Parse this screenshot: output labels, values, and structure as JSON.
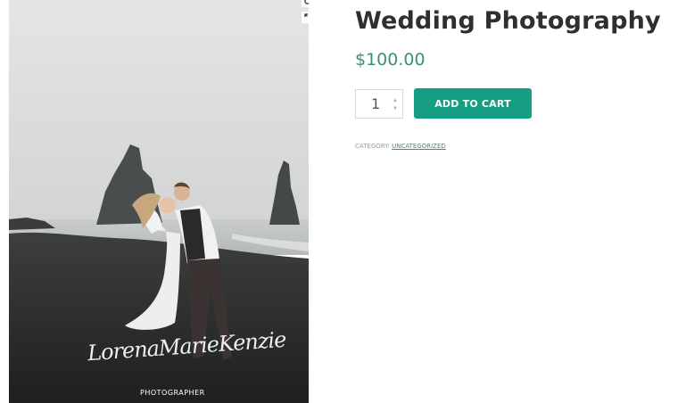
{
  "product": {
    "title": "Wedding Photography",
    "price": "$100.00",
    "quantity": "1",
    "add_to_cart_label": "ADD TO CART",
    "category_label": "CATEGORY:",
    "category_link": "UNCATEGORIZED"
  },
  "image": {
    "signature_text": "LorenaMarieKenzie",
    "photographer_caption": "PHOTOGRAPHER"
  },
  "icons": {
    "zoom": "magnifier-icon",
    "expand": "expand-icon",
    "spin_up": "chevron-up-icon",
    "spin_down": "chevron-down-icon"
  },
  "colors": {
    "accent": "#159e83",
    "price": "#3b8f7a",
    "title": "#2f2f2f"
  }
}
